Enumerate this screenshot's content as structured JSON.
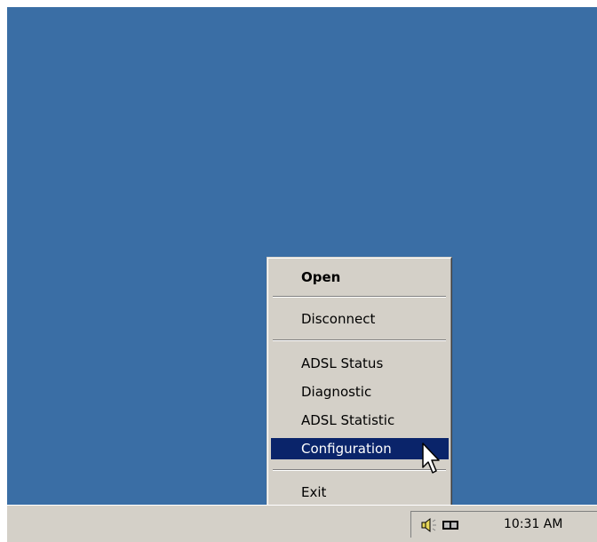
{
  "context_menu": {
    "items": [
      {
        "label": "Open",
        "bold": true
      },
      {
        "label": "Disconnect"
      },
      {
        "label": "ADSL Status"
      },
      {
        "label": "Diagnostic"
      },
      {
        "label": "ADSL Statistic"
      },
      {
        "label": "Configuration",
        "highlighted": true
      },
      {
        "label": "Exit"
      }
    ]
  },
  "taskbar": {
    "tray": {
      "icons": [
        "speaker-icon",
        "network-adapter-icon"
      ],
      "clock": "10:31 AM"
    }
  },
  "colors": {
    "desktop": "#3a6ea5",
    "menu_face": "#d4d0c8",
    "highlight": "#0a246a"
  }
}
